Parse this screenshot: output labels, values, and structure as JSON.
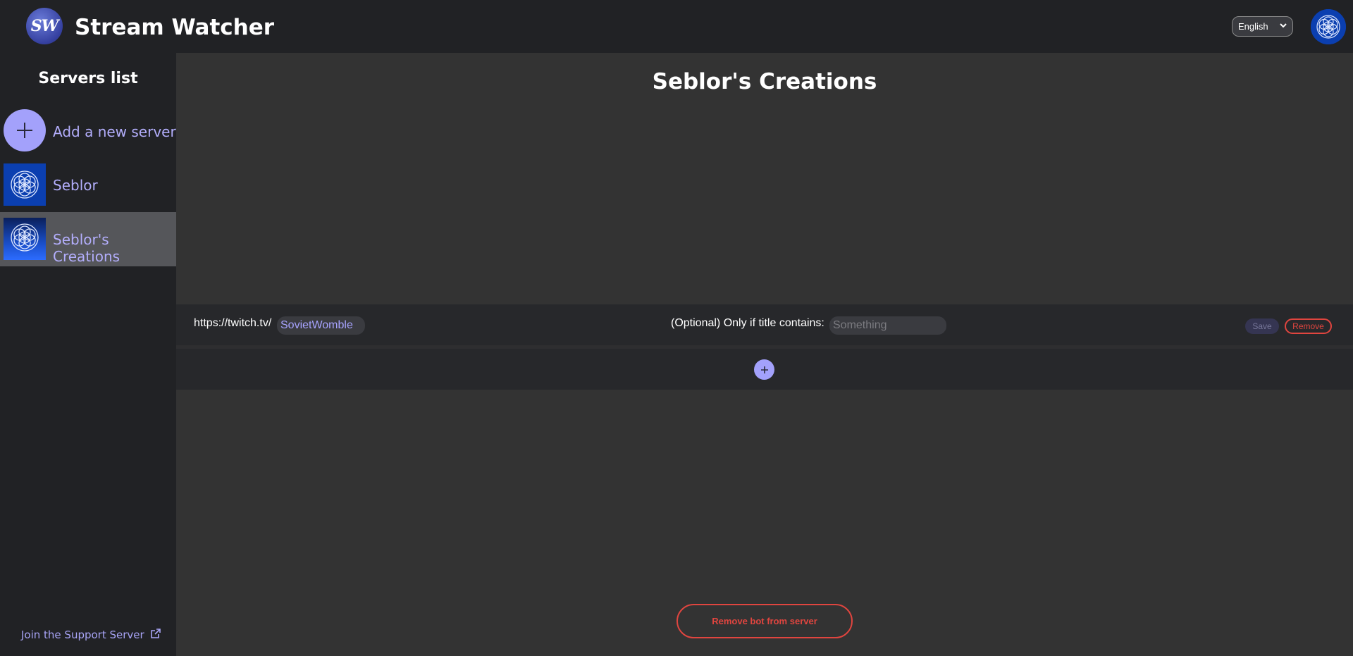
{
  "header": {
    "logo_text": "SW",
    "title": "Stream Watcher",
    "language": "English"
  },
  "sidebar": {
    "title": "Servers list",
    "add_label": "Add a new server",
    "servers": [
      {
        "name": "Seblor"
      },
      {
        "name": "Seblor's Creations"
      }
    ],
    "support_link": "Join the Support Server"
  },
  "main": {
    "server_title": "Seblor's Creations",
    "streams": [
      {
        "url_prefix": "https://twitch.tv/",
        "channel": "SovietWomble",
        "title_filter_label": "(Optional) Only if title contains:",
        "title_filter_placeholder": "Something",
        "save_label": "Save",
        "remove_label": "Remove"
      }
    ],
    "remove_bot_label": "Remove bot from server"
  },
  "colors": {
    "accent": "#a3a1fb",
    "danger": "#e0453f",
    "header_bg": "#212225",
    "main_bg": "#333333"
  }
}
